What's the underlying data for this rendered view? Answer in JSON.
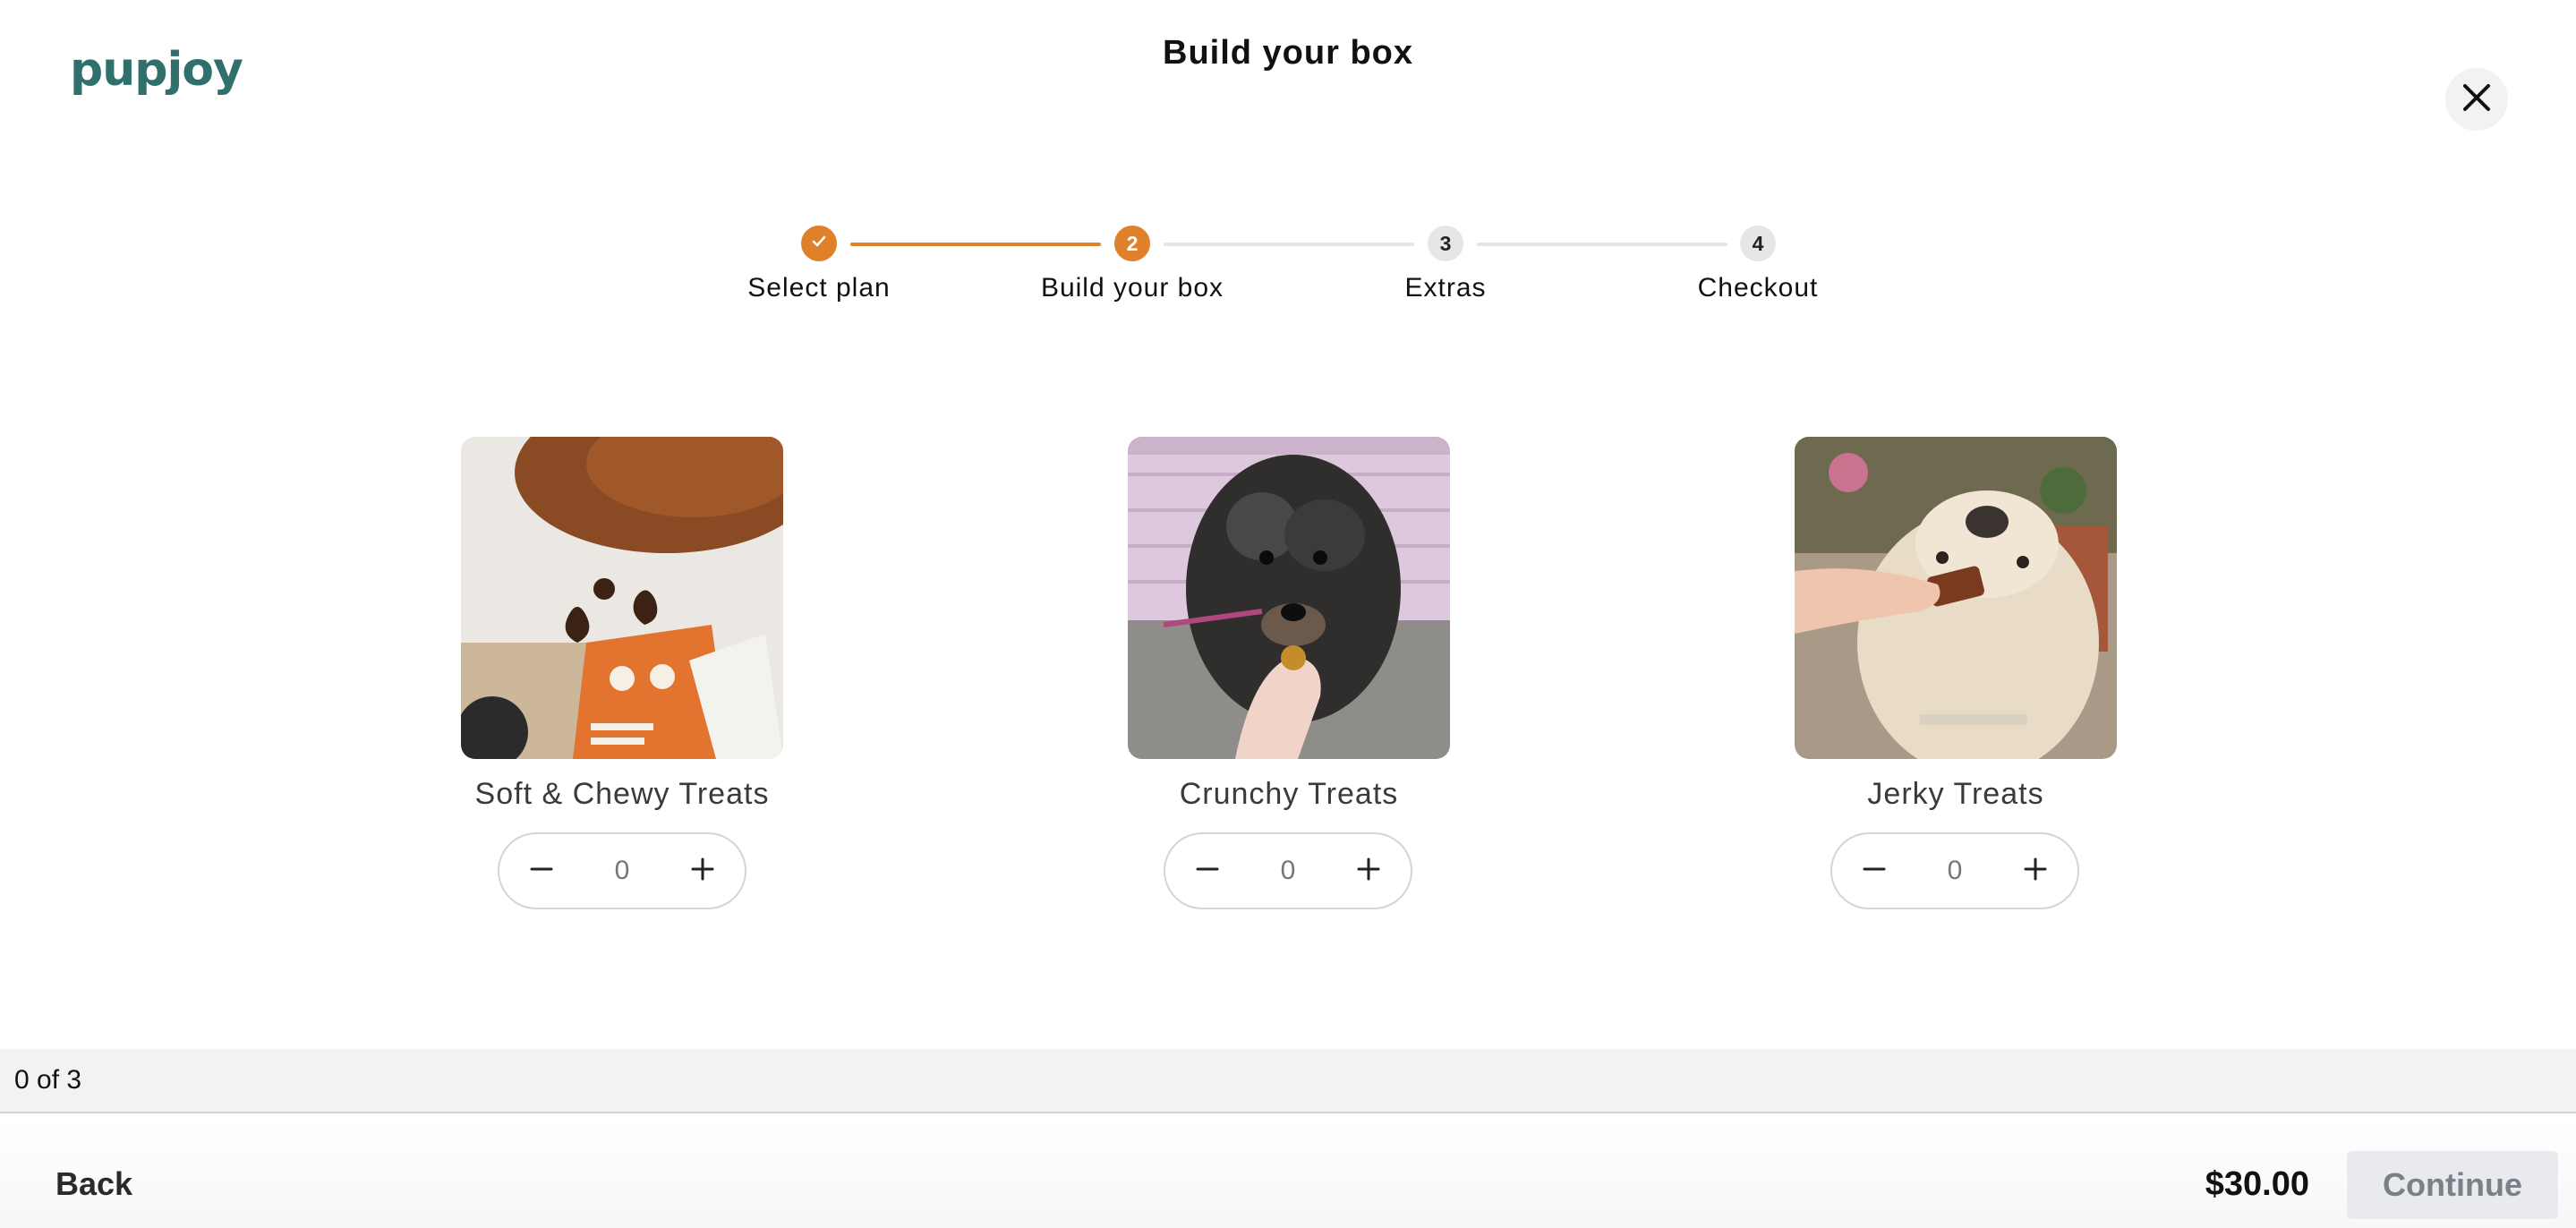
{
  "header": {
    "logo_text": "pupjoy",
    "title": "Build your box",
    "close_icon": "close-icon"
  },
  "stepper": {
    "steps": [
      {
        "number": "1",
        "label": "Select plan",
        "state": "completed",
        "icon": "check-icon"
      },
      {
        "number": "2",
        "label": "Build your box",
        "state": "active"
      },
      {
        "number": "3",
        "label": "Extras",
        "state": "upcoming"
      },
      {
        "number": "4",
        "label": "Checkout",
        "state": "upcoming"
      }
    ],
    "accent_color": "#e0802a"
  },
  "products": [
    {
      "name": "Soft & Chewy Treats",
      "quantity": "0"
    },
    {
      "name": "Crunchy Treats",
      "quantity": "0"
    },
    {
      "name": "Jerky Treats",
      "quantity": "0"
    }
  ],
  "progress": {
    "text": "0 of 3"
  },
  "footer": {
    "back_label": "Back",
    "price": "$30.00",
    "continue_label": "Continue"
  }
}
